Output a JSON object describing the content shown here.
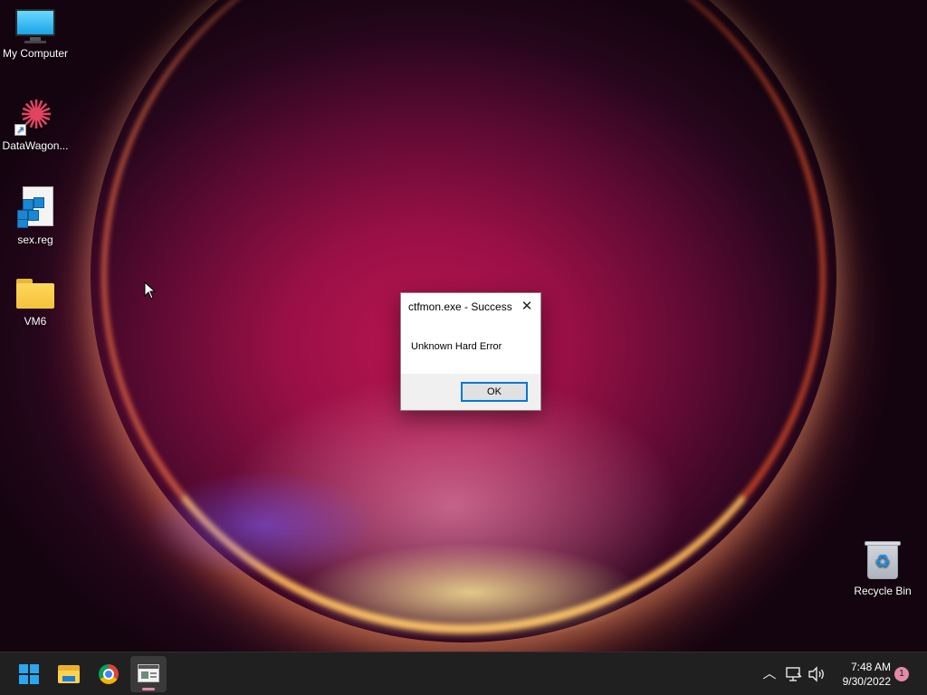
{
  "desktop": {
    "icons": [
      {
        "label": "My Computer",
        "icon": "monitor-icon"
      },
      {
        "label": "DataWagon...",
        "icon": "app-shortcut-icon"
      },
      {
        "label": "sex.reg",
        "icon": "registry-file-icon"
      },
      {
        "label": "VM6",
        "icon": "folder-icon"
      },
      {
        "label": "Recycle Bin",
        "icon": "recycle-bin-icon"
      }
    ]
  },
  "dialog": {
    "title": "ctfmon.exe - Success",
    "close_glyph": "✕",
    "message": "Unknown Hard Error",
    "ok_label": "OK"
  },
  "taskbar": {
    "pinned": [
      {
        "name": "Start",
        "icon": "windows-start-icon"
      },
      {
        "name": "File Explorer",
        "icon": "file-explorer-icon"
      },
      {
        "name": "Google Chrome",
        "icon": "chrome-icon"
      },
      {
        "name": "Active window",
        "icon": "app-window-icon",
        "active": true
      }
    ],
    "tray": {
      "overflow_glyph": "︿",
      "network_icon": "network-icon",
      "volume_icon": "volume-icon",
      "time": "7:48 AM",
      "date": "9/30/2022",
      "notification_count": "1"
    },
    "accent_color": "#e38aa6"
  }
}
